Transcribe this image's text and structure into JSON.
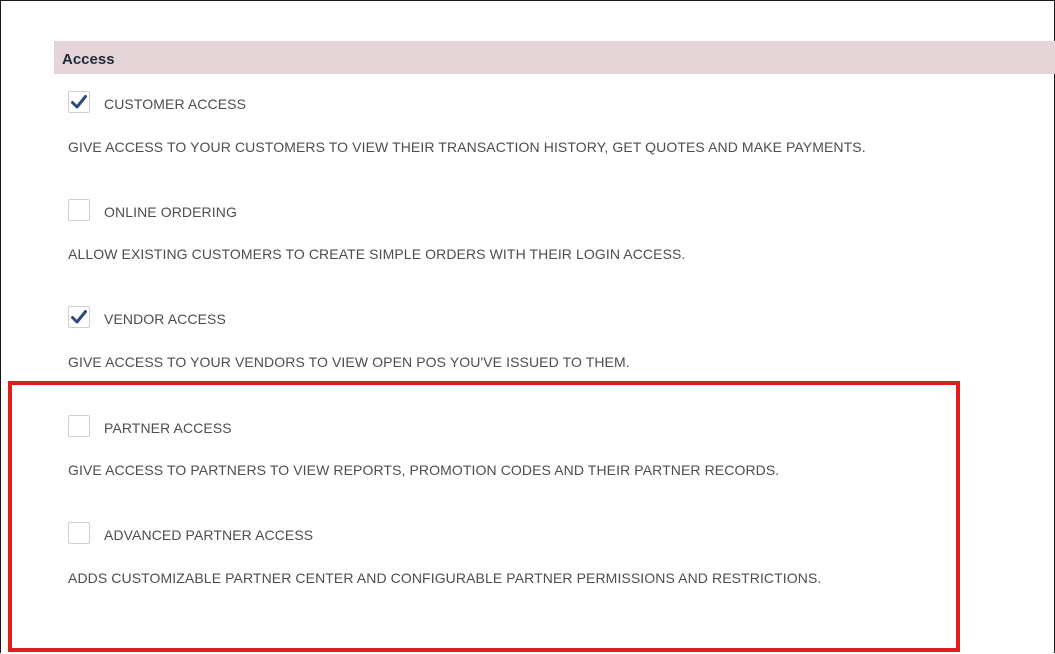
{
  "section": {
    "title": "Access"
  },
  "options": [
    {
      "label": "CUSTOMER ACCESS",
      "checked": true,
      "description": "GIVE ACCESS TO YOUR CUSTOMERS TO VIEW THEIR TRANSACTION HISTORY, GET QUOTES AND MAKE PAYMENTS."
    },
    {
      "label": "ONLINE ORDERING",
      "checked": false,
      "description": "ALLOW EXISTING CUSTOMERS TO CREATE SIMPLE ORDERS WITH THEIR LOGIN ACCESS."
    },
    {
      "label": "VENDOR ACCESS",
      "checked": true,
      "description": "GIVE ACCESS TO YOUR VENDORS TO VIEW OPEN POS YOU'VE ISSUED TO THEM."
    },
    {
      "label": "PARTNER ACCESS",
      "checked": false,
      "description": "GIVE ACCESS TO PARTNERS TO VIEW REPORTS, PROMOTION CODES AND THEIR PARTNER RECORDS."
    },
    {
      "label": "ADVANCED PARTNER ACCESS",
      "checked": false,
      "description": "ADDS CUSTOMIZABLE PARTNER CENTER AND CONFIGURABLE PARTNER PERMISSIONS AND RESTRICTIONS."
    }
  ],
  "colors": {
    "header_bg": "#e6d5d8",
    "checkmark": "#2e4a7d",
    "highlight": "#e01d1d",
    "text": "#4d4d4d"
  }
}
